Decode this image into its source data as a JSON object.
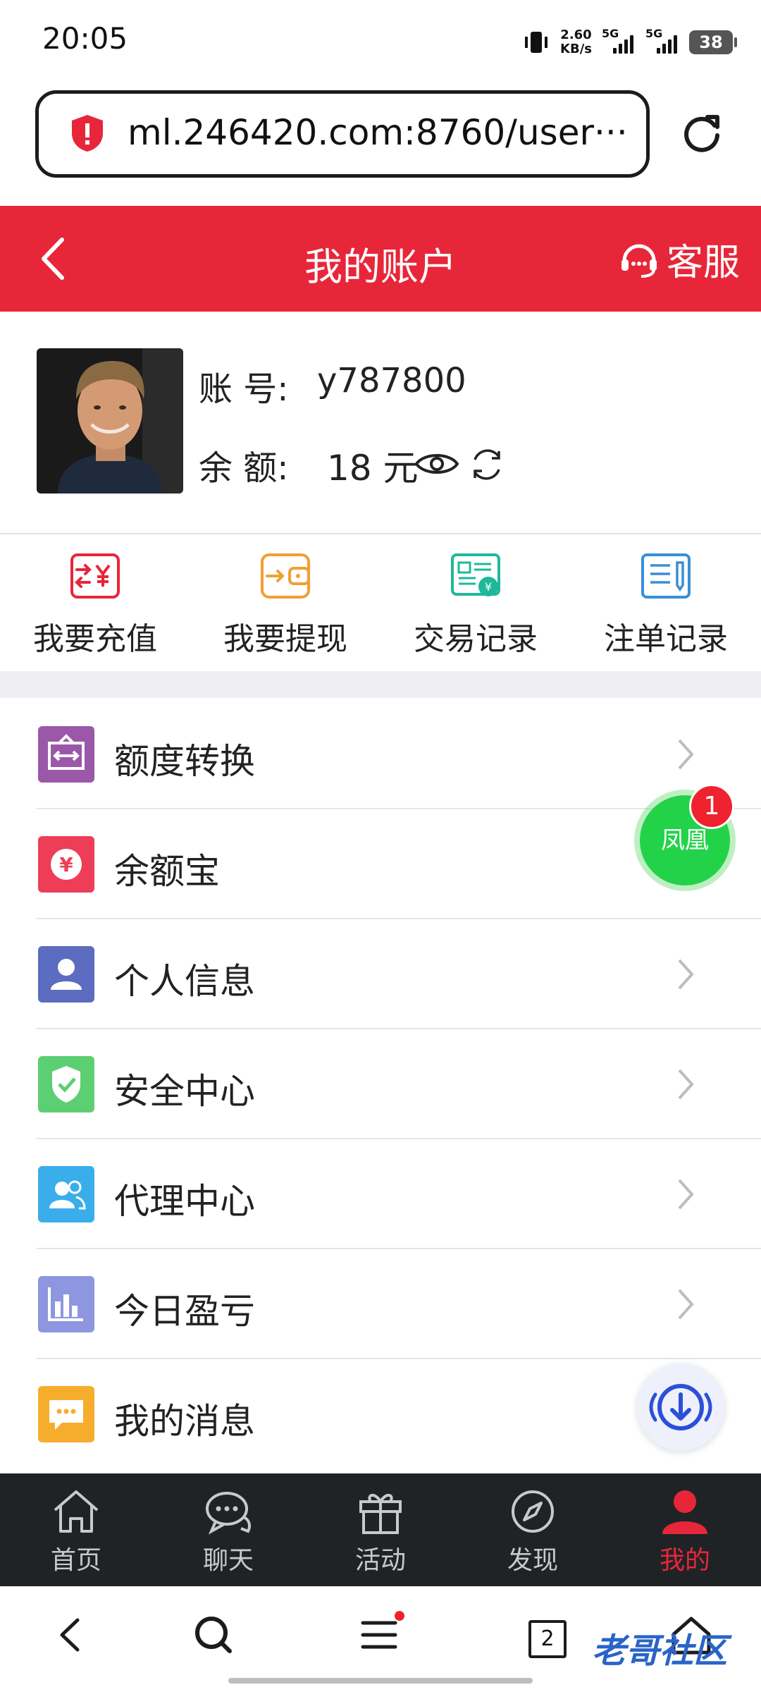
{
  "status_bar": {
    "time": "20:05",
    "net_speed_value": "2.60",
    "net_speed_unit": "KB/s",
    "signal1_label": "5G",
    "signal2_label": "5G",
    "battery": "38"
  },
  "browser": {
    "url": "ml.246420.com:8760/user···",
    "tab_count": "2",
    "menu_has_dot": true
  },
  "header": {
    "title": "我的账户",
    "service_label": "客服",
    "bg_color": "#e8263a"
  },
  "account": {
    "account_label": "账 号:",
    "account_value": "y787800",
    "balance_label": "余 额:",
    "balance_value": "18 元"
  },
  "quick_actions": [
    {
      "label": "我要充值",
      "icon": "recharge-icon",
      "color": "#e8263a"
    },
    {
      "label": "我要提现",
      "icon": "withdraw-icon",
      "color": "#f0a030"
    },
    {
      "label": "交易记录",
      "icon": "transaction-record-icon",
      "color": "#1fb89a"
    },
    {
      "label": "注单记录",
      "icon": "bet-record-icon",
      "color": "#3a8fd6"
    }
  ],
  "menu": [
    {
      "label": "额度转换",
      "icon": "transfer-icon",
      "color": "#9b57a8"
    },
    {
      "label": "余额宝",
      "icon": "yuebao-icon",
      "color": "#ee3d56"
    },
    {
      "label": "个人信息",
      "icon": "person-icon",
      "color": "#5c6cc0"
    },
    {
      "label": "安全中心",
      "icon": "shield-check-icon",
      "color": "#5ccf73"
    },
    {
      "label": "代理中心",
      "icon": "agent-icon",
      "color": "#3aaeea"
    },
    {
      "label": "今日盈亏",
      "icon": "bar-chart-icon",
      "color": "#8e96e0"
    },
    {
      "label": "我的消息",
      "icon": "message-icon",
      "color": "#f7ad2c"
    }
  ],
  "floating": {
    "fenghuang_label": "凤凰",
    "fenghuang_badge": "1"
  },
  "tabbar": [
    {
      "label": "首页",
      "icon": "home-icon",
      "active": false
    },
    {
      "label": "聊天",
      "icon": "chat-icon",
      "active": false
    },
    {
      "label": "活动",
      "icon": "gift-icon",
      "active": false
    },
    {
      "label": "发现",
      "icon": "compass-icon",
      "active": false
    },
    {
      "label": "我的",
      "icon": "user-icon",
      "active": true
    }
  ],
  "watermark": "老哥社区"
}
